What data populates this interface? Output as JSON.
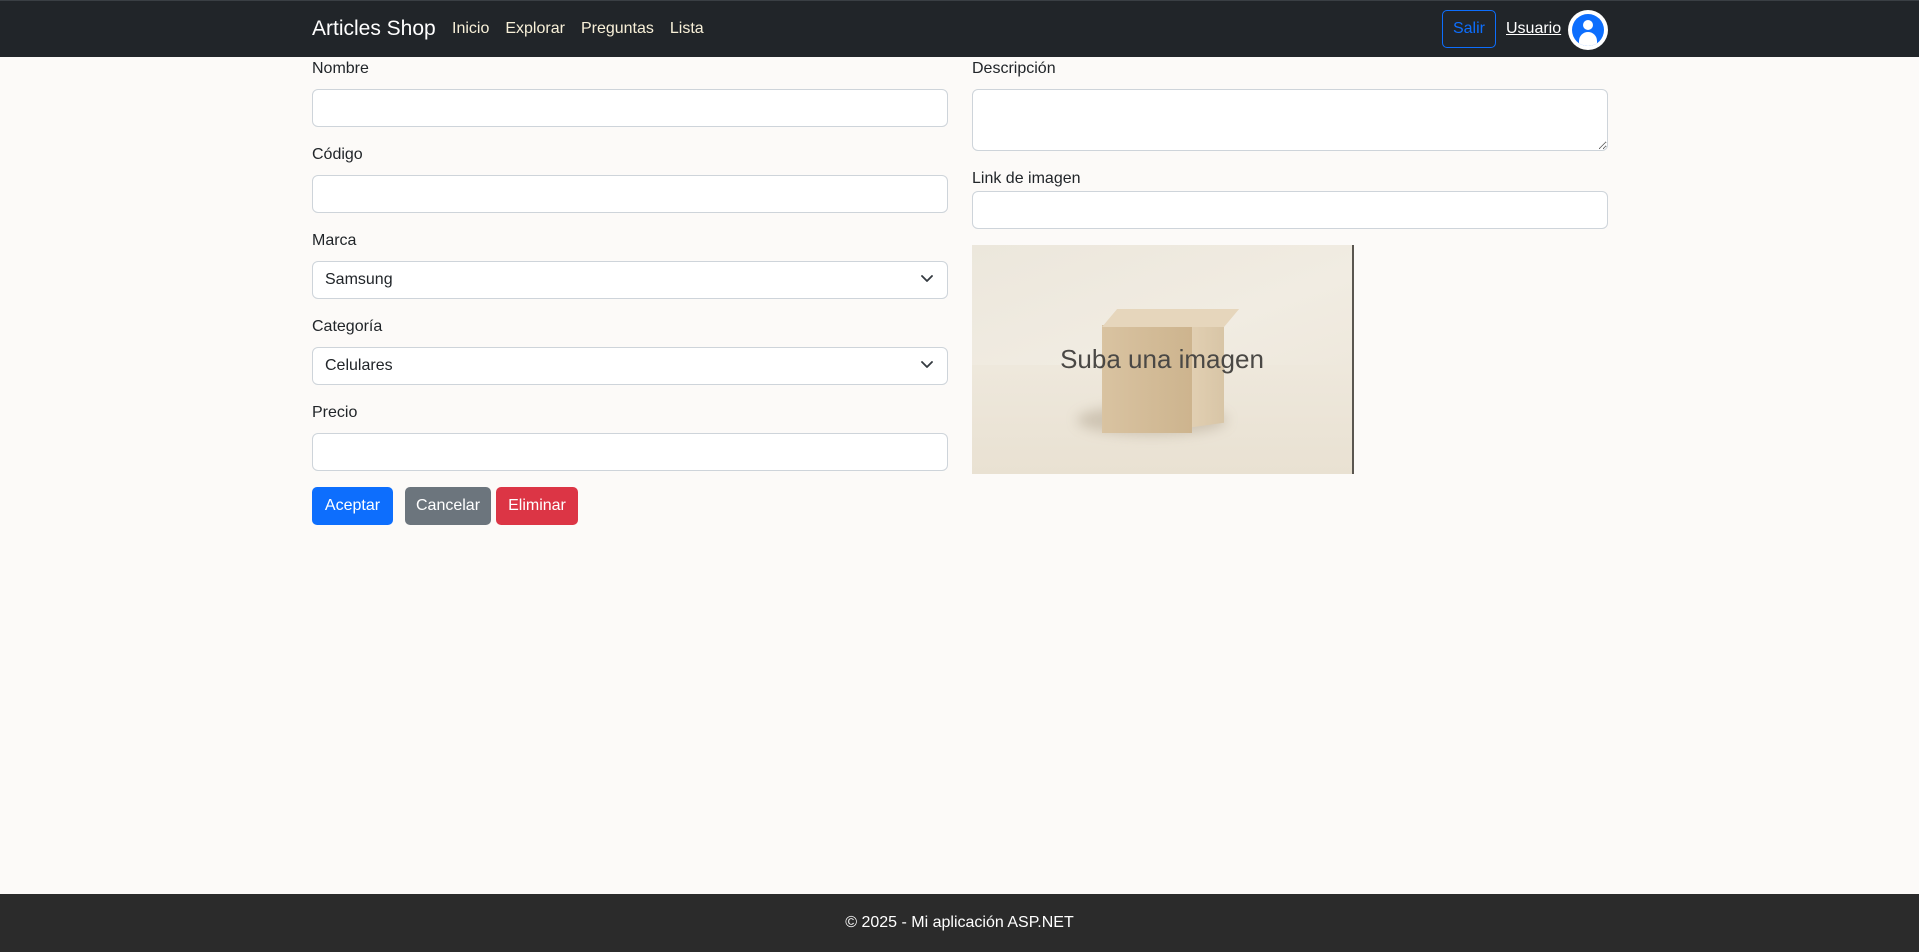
{
  "navbar": {
    "brand": "Articles Shop",
    "links": [
      "Inicio",
      "Explorar",
      "Preguntas",
      "Lista"
    ],
    "logout_label": "Salir",
    "user_label": "Usuario",
    "avatar_icon": "user-avatar-icon"
  },
  "form": {
    "nombre": {
      "label": "Nombre",
      "value": ""
    },
    "codigo": {
      "label": "Código",
      "value": ""
    },
    "marca": {
      "label": "Marca",
      "selected": "Samsung"
    },
    "categoria": {
      "label": "Categoría",
      "selected": "Celulares"
    },
    "precio": {
      "label": "Precio",
      "value": ""
    },
    "descripcion": {
      "label": "Descripción",
      "value": ""
    },
    "imagen": {
      "label": "Link de imagen",
      "value": ""
    },
    "image_placeholder": "Suba una imagen"
  },
  "buttons": {
    "accept": "Aceptar",
    "cancel": "Cancelar",
    "delete": "Eliminar"
  },
  "colors": {
    "primary": "#0d6efd",
    "secondary": "#6c757d",
    "danger": "#dc3545",
    "navbar": "#212529"
  },
  "footer": {
    "text": "© 2025 - Mi aplicación ASP.NET"
  }
}
